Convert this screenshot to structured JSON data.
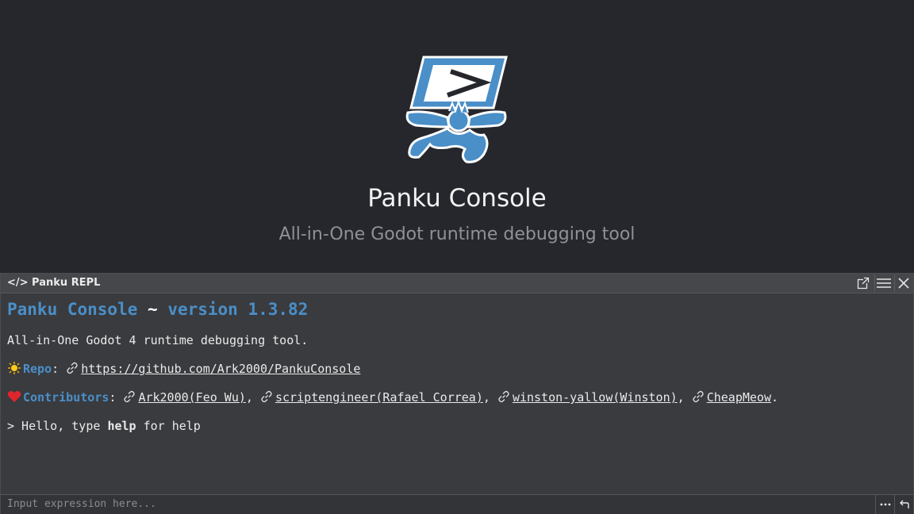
{
  "splash": {
    "title": "Panku Console",
    "subtitle": "All-in-One Godot runtime debugging tool",
    "logo_icon": "panku-logo-icon"
  },
  "window": {
    "title": "</> Panku REPL",
    "buttons": [
      "popout-icon",
      "menu-icon",
      "close-icon"
    ]
  },
  "output": {
    "heading_name": "Panku Console",
    "heading_sep": " ~ ",
    "heading_version": "version 1.3.82",
    "description": "All-in-One Godot 4 runtime debugging tool.",
    "repo_label": "Repo",
    "repo_url": "https://github.com/Ark2000/PankuConsole",
    "contributors_label": "Contributors",
    "contributors": [
      "Ark2000(Feo Wu)",
      "scriptengineer(Rafael Correa)",
      "winston-yallow(Winston)",
      "CheapMeow"
    ],
    "hello_prefix": "> Hello, type ",
    "hello_bold": "help",
    "hello_suffix": " for help"
  },
  "input": {
    "placeholder": "Input expression here...",
    "value": ""
  },
  "colors": {
    "background": "#25272c",
    "accent": "#4a8fc8",
    "panel": "#3a3b3f"
  }
}
